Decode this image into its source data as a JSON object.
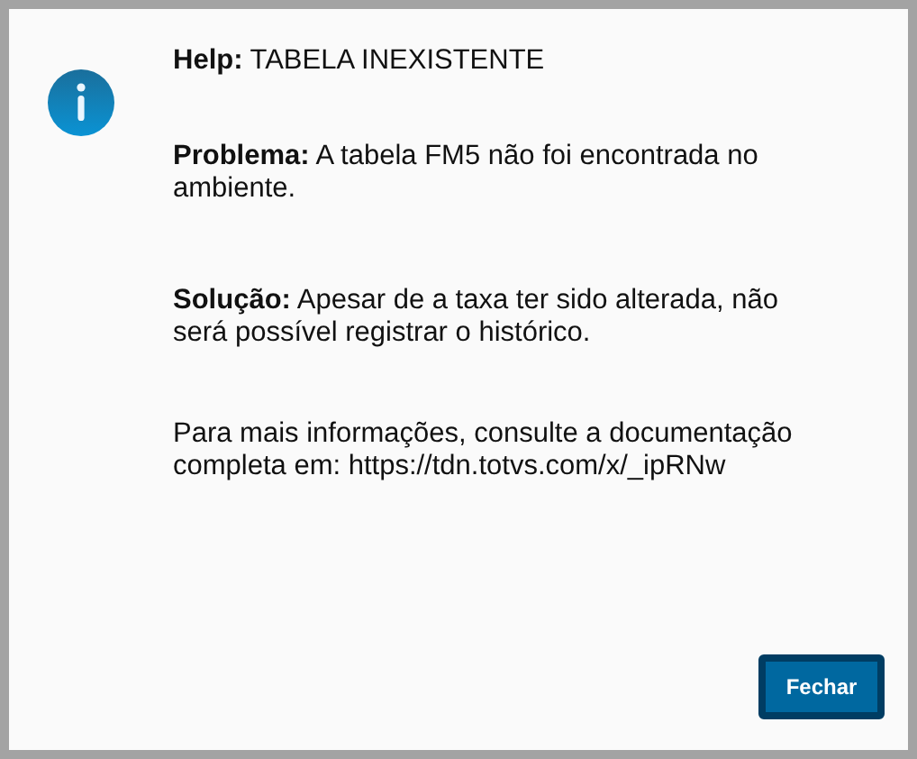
{
  "dialog": {
    "paragraphs": [
      "**Help:** TABELA INEXISTENTE",
      "**Problema:** A tabela FM5 não foi encontrada no ambiente.",
      "**Solução:** Apesar de a taxa ter sido alterada, não será possível registrar o histórico.",
      "Para mais informações, consulte a documentação completa em: https://tdn.totvs.com/x/_ipRNw"
    ],
    "buttons": [
      "Fechar"
    ]
  }
}
